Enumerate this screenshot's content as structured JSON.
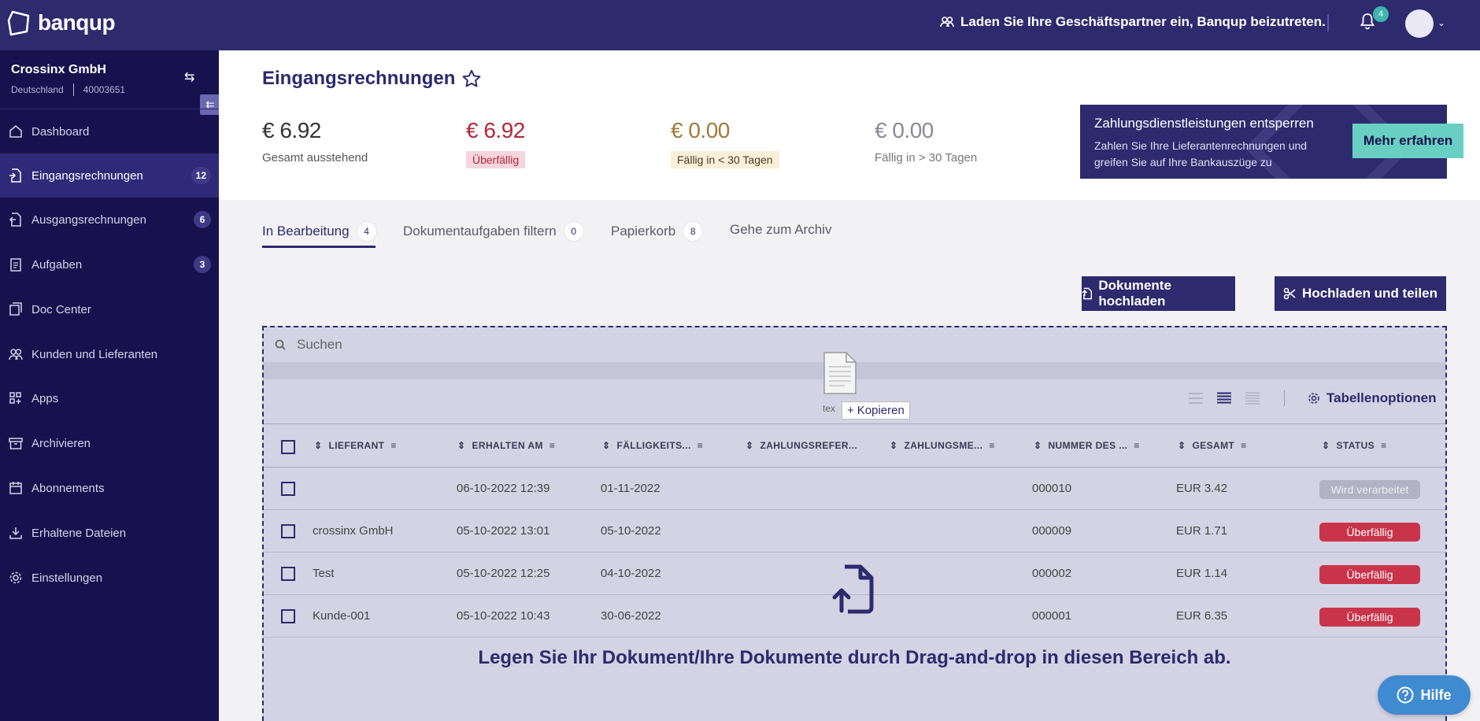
{
  "app": {
    "name": "banqup"
  },
  "header": {
    "invite_text": "Laden Sie Ihre Geschäftspartner ein, Banqup beizutreten.",
    "notification_count": "4"
  },
  "company": {
    "name": "Crossinx GmbH",
    "country": "Deutschland",
    "id": "40003651"
  },
  "sidebar": {
    "items": [
      {
        "label": "Dashboard",
        "badge": ""
      },
      {
        "label": "Eingangsrechnungen",
        "badge": "12"
      },
      {
        "label": "Ausgangsrechnungen",
        "badge": "6"
      },
      {
        "label": "Aufgaben",
        "badge": "3"
      },
      {
        "label": "Doc Center",
        "badge": ""
      },
      {
        "label": "Kunden und Lieferanten",
        "badge": ""
      },
      {
        "label": "Apps",
        "badge": ""
      },
      {
        "label": "Archivieren",
        "badge": ""
      },
      {
        "label": "Abonnements",
        "badge": ""
      },
      {
        "label": "Erhaltene Dateien",
        "badge": ""
      },
      {
        "label": "Einstellungen",
        "badge": ""
      }
    ]
  },
  "page": {
    "title": "Eingangsrechnungen"
  },
  "stats": [
    {
      "value": "€ 6.92",
      "label": "Gesamt ausstehend"
    },
    {
      "value": "€ 6.92",
      "label": "Überfällig"
    },
    {
      "value": "€ 0.00",
      "label": "Fällig in < 30 Tagen"
    },
    {
      "value": "€ 0.00",
      "label": "Fällig in > 30 Tagen"
    }
  ],
  "promo": {
    "title": "Zahlungsdienstleistungen entsperren",
    "text": "Zahlen Sie Ihre Lieferantenrechnungen und greifen Sie auf Ihre Bankauszüge zu",
    "button": "Mehr erfahren"
  },
  "tabs": [
    {
      "label": "In Bearbeitung",
      "badge": "4"
    },
    {
      "label": "Dokumentaufgaben filtern",
      "badge": "0"
    },
    {
      "label": "Papierkorb",
      "badge": "8"
    },
    {
      "label": "Gehe zum Archiv",
      "badge": ""
    }
  ],
  "actions": {
    "upload": "Dokumente hochladen",
    "upload_split": "Hochladen und teilen"
  },
  "search": {
    "placeholder": "Suchen"
  },
  "table_options": "Tabellenoptionen",
  "drag": {
    "ghost_label": "tex",
    "copy_label": "Kopieren"
  },
  "table": {
    "columns": [
      "LIEFERANT",
      "ERHALTEN AM",
      "FÄLLIGKEITS...",
      "ZAHLUNGSREFER...",
      "ZAHLUNGSME...",
      "NUMMER DES ...",
      "GESAMT",
      "STATUS"
    ],
    "rows": [
      {
        "supplier": "",
        "received": "06-10-2022 12:39",
        "due": "01-11-2022",
        "number": "000010",
        "total": "EUR 3.42",
        "status": "Wird verarbeitet"
      },
      {
        "supplier": "crossinx GmbH",
        "received": "05-10-2022 13:01",
        "due": "05-10-2022",
        "number": "000009",
        "total": "EUR 1.71",
        "status": "Überfällig"
      },
      {
        "supplier": "Test",
        "received": "05-10-2022 12:25",
        "due": "04-10-2022",
        "number": "000002",
        "total": "EUR 1.14",
        "status": "Überfällig"
      },
      {
        "supplier": "Kunde-001",
        "received": "05-10-2022 10:43",
        "due": "30-06-2022",
        "number": "000001",
        "total": "EUR 6.35",
        "status": "Überfällig"
      }
    ]
  },
  "drop_hint": "Legen Sie Ihr Dokument/Ihre Dokumente durch Drag-and-drop in diesen Bereich ab.",
  "help": "Hilfe",
  "colors": {
    "brand": "#2d2a6e",
    "sidebar": "#17124d",
    "accent": "#69cfc3",
    "danger": "#c9344a"
  }
}
